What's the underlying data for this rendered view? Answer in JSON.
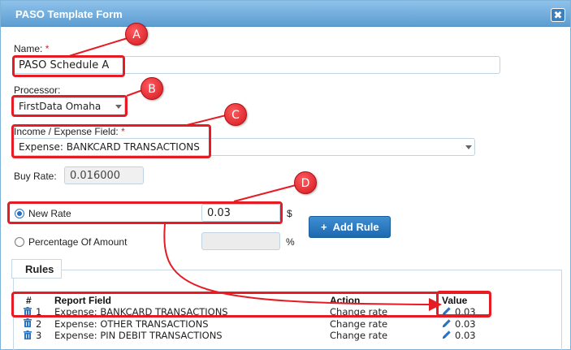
{
  "dialog": {
    "title": "PASO Template Form",
    "close_glyph": "✖"
  },
  "form": {
    "name_label": "Name:",
    "required_mark": "*",
    "name_value": "PASO Schedule A",
    "processor_label": "Processor:",
    "processor_value": "FirstData Omaha",
    "income_label": "Income / Expense Field:",
    "income_value": "Expense: BANKCARD TRANSACTIONS",
    "buy_rate_label": "Buy Rate:",
    "buy_rate_value": "0.016000",
    "new_rate_label": "New Rate",
    "new_rate_value": "0.03",
    "new_rate_unit": "$",
    "percentage_label": "Percentage Of Amount",
    "percentage_value": "",
    "percentage_unit": "%",
    "add_rule_label": "Add Rule",
    "add_rule_glyph": "+"
  },
  "rules": {
    "legend": "Rules",
    "headers": {
      "num": "#",
      "field": "Report Field",
      "action": "Action",
      "value": "Value"
    },
    "rows": [
      {
        "num": "1",
        "field": "Expense: BANKCARD TRANSACTIONS",
        "action": "Change rate",
        "value": "0.03"
      },
      {
        "num": "2",
        "field": "Expense: OTHER TRANSACTIONS",
        "action": "Change rate",
        "value": "0.03"
      },
      {
        "num": "3",
        "field": "Expense: PIN DEBIT TRANSACTIONS",
        "action": "Change rate",
        "value": "0.03"
      }
    ]
  },
  "annotations": {
    "a": "A",
    "b": "B",
    "c": "C",
    "d": "D"
  },
  "icons": {
    "trash": "trash-icon",
    "pencil": "pencil-icon",
    "close": "close-icon",
    "caret": "chevron-down-icon"
  },
  "colors": {
    "accent": "#2a6fc6",
    "titlebar": "#6aa8dc",
    "annotation": "#e51c23"
  }
}
